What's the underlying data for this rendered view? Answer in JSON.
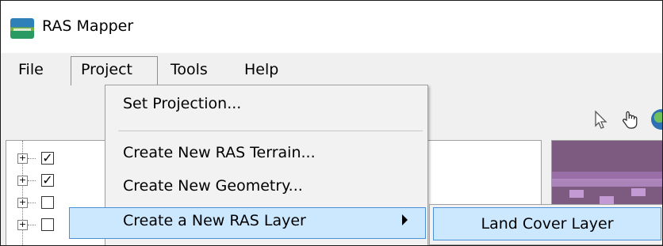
{
  "window": {
    "title": "RAS Mapper",
    "icon": "ras-mapper-app-icon"
  },
  "menubar": {
    "items": [
      "File",
      "Project",
      "Tools",
      "Help"
    ],
    "active": "Project"
  },
  "project_menu": {
    "items": [
      {
        "label": "Set Projection..."
      },
      {
        "label": "Create New RAS Terrain..."
      },
      {
        "label": "Create New Geometry..."
      },
      {
        "label": "Create a New RAS Layer",
        "has_submenu": true,
        "highlighted": true
      }
    ]
  },
  "submenu": {
    "items": [
      {
        "label": "Land Cover Layer",
        "highlighted": true
      }
    ]
  },
  "toolbar": {
    "icons": [
      "pointer-arrow-icon",
      "hand-pan-icon",
      "globe-icon"
    ]
  },
  "layer_tree": {
    "rows": [
      {
        "checked": true
      },
      {
        "checked": true
      },
      {
        "checked": false
      },
      {
        "checked": false
      }
    ]
  },
  "colors": {
    "highlight_fill": "#cce8ff",
    "highlight_border": "#4a8fd8"
  }
}
